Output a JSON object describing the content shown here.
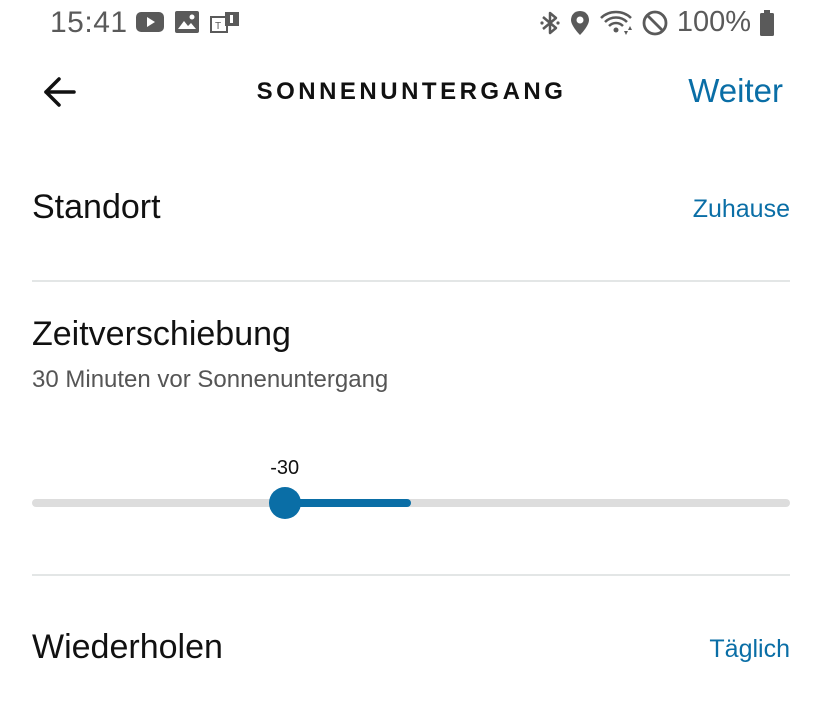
{
  "status_bar": {
    "time": "15:41",
    "battery": "100%",
    "left_icons": [
      "youtube-icon",
      "gallery-icon",
      "notification-app-icon"
    ],
    "right_icons": [
      "bluetooth-icon",
      "location-icon",
      "wifi-icon",
      "do-not-disturb-icon",
      "battery-icon"
    ]
  },
  "header": {
    "title": "SONNENUNTERGANG",
    "next_label": "Weiter",
    "back_icon": "arrow-left-icon"
  },
  "location": {
    "label": "Standort",
    "value": "Zuhause"
  },
  "offset": {
    "label": "Zeitverschiebung",
    "subtext": "30 Minuten vor Sonnenuntergang",
    "slider_value": "-30",
    "slider_min": -90,
    "slider_max": 90,
    "slider_current": -30,
    "slider_center": 0
  },
  "repeat": {
    "label": "Wiederholen",
    "value": "Täglich"
  },
  "colors": {
    "accent": "#0a6ea6",
    "track": "#dddddd",
    "divider": "#e3e6e6",
    "text": "#111111",
    "subtext": "#555555"
  }
}
